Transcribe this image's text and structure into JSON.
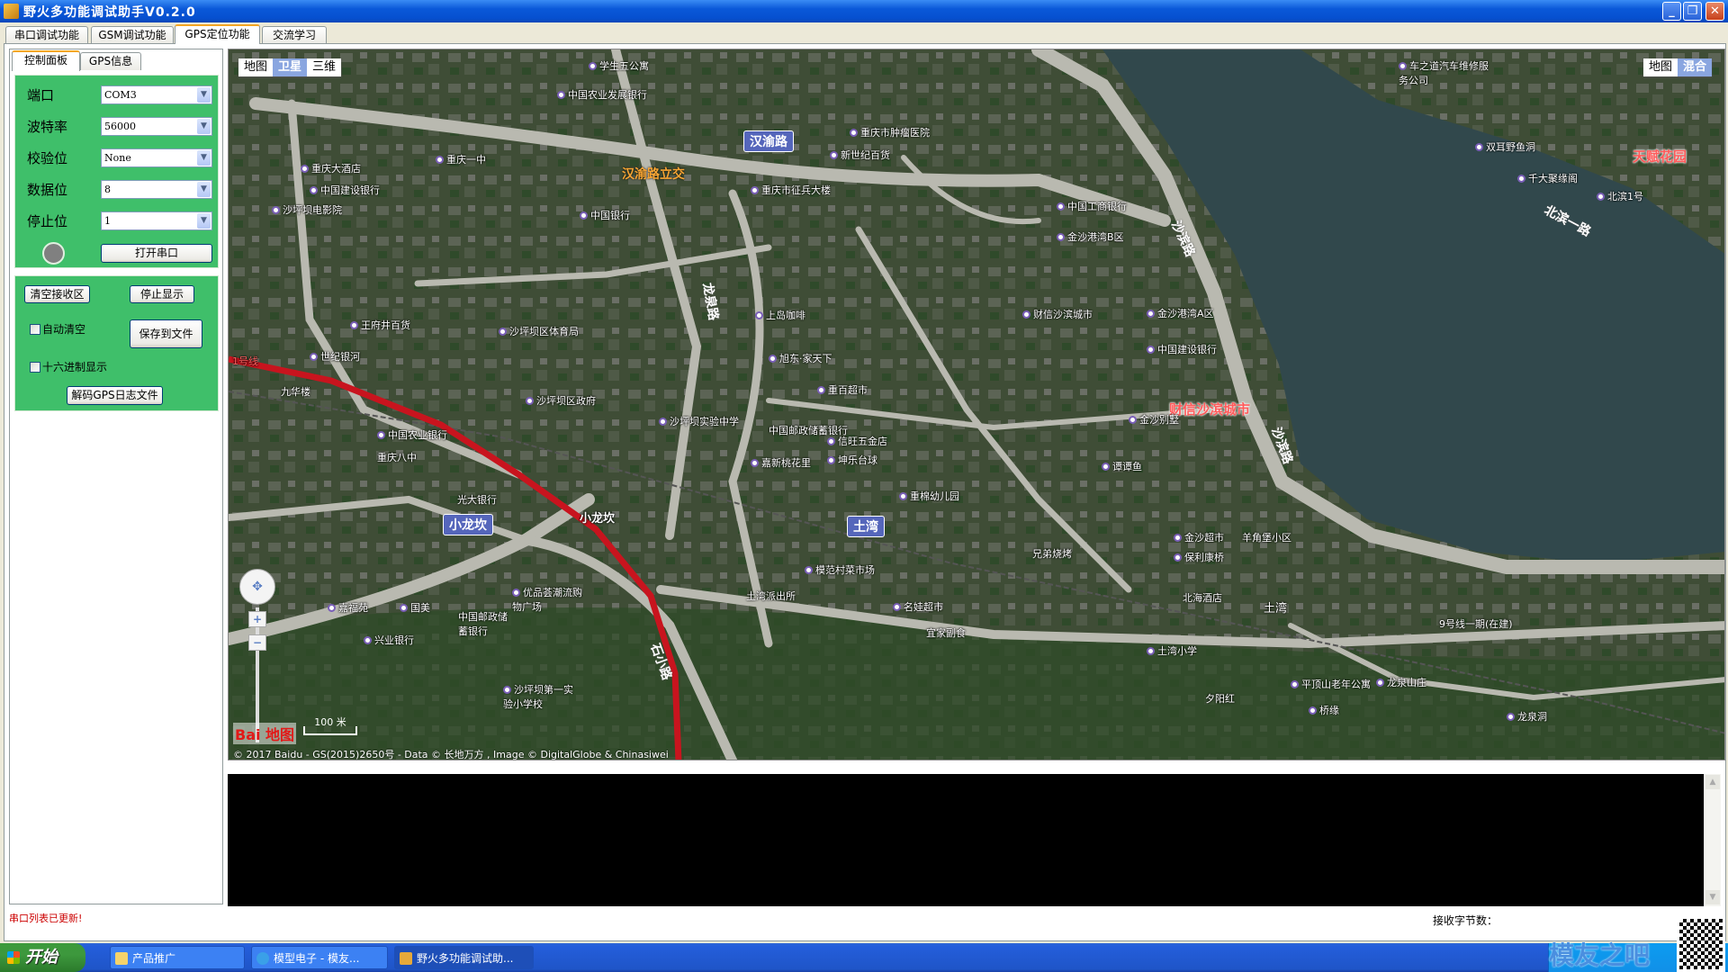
{
  "window": {
    "title": "野火多功能调试助手V0.2.0"
  },
  "main_tabs": [
    "串口调试功能",
    "GSM调试功能",
    "GPS定位功能",
    "交流学习"
  ],
  "sub_tabs": [
    "控制面板",
    "GPS信息"
  ],
  "serial": {
    "port_label": "端口",
    "port_value": "COM3",
    "baud_label": "波特率",
    "baud_value": "56000",
    "parity_label": "校验位",
    "parity_value": "None",
    "databits_label": "数据位",
    "databits_value": "8",
    "stopbits_label": "停止位",
    "stopbits_value": "1",
    "open_button": "打开串口",
    "status_led_color": "#808080"
  },
  "receive": {
    "clear_button": "清空接收区",
    "stop_button": "停止显示",
    "auto_clear_label": "自动清空",
    "auto_clear_checked": false,
    "save_button": "保存到文件",
    "hex_label": "十六进制显示",
    "hex_checked": false,
    "decode_button": "解码GPS日志文件"
  },
  "map": {
    "type_left": [
      "地图",
      "卫星",
      "三维"
    ],
    "type_left_active": "卫星",
    "type_right": [
      "地图",
      "混合"
    ],
    "type_right_active": "混合",
    "scale": "100 米",
    "logo": "Bai 地图",
    "copyright": "© 2017 Baidu - GS(2015)2650号 - Data © 长地万方 , Image © DigitalGlobe & Chinasiwei",
    "districts": [
      "汉渝路",
      "小龙坎",
      "土湾"
    ],
    "highlights": [
      "汉渝路立交",
      "财信沙滨城市",
      "天赋花园"
    ],
    "roads": [
      "沙滨路",
      "北滨一路",
      "石小路",
      "龙泉路",
      "沙滨路",
      "9号线一期(在建)",
      "1号线"
    ],
    "pois": [
      "学生五公寓",
      "重庆一中",
      "中国农业发展银行",
      "重庆市肿瘤医院",
      "新世纪百货",
      "重庆市征兵大楼",
      "中国银行",
      "中国建设银行",
      "中国工商银行",
      "金沙港湾B区",
      "沙坪坝区体育局",
      "王府井百货",
      "世纪银河",
      "九华楼",
      "中国农业银行",
      "重庆八中",
      "光大银行",
      "小龙坎",
      "沙坪坝区政府",
      "沙坪坝实验中学",
      "上岛咖啡",
      "旭东·家天下",
      "重百超市",
      "中国邮政储蓄银行",
      "信旺五金店",
      "坤乐台球",
      "嘉新桃花里",
      "重棉幼儿园",
      "模范村菜市场",
      "土湾派出所",
      "兄弟烧烤",
      "名娃超市",
      "宜家副食",
      "中国建设银行",
      "金沙别墅",
      "谭谭鱼",
      "金沙超市",
      "羊角堡小区",
      "保利康桥",
      "北海酒店",
      "土湾",
      "土湾小学",
      "平顶山老年公寓",
      "龙泉山庄",
      "夕阳红",
      "桥缘",
      "龙泉洞",
      "兴业银行",
      "国美",
      "嘉福苑",
      "优品荟潮流购物广场",
      "沙坪坝第一实验小学校",
      "中国邮政储蓄银行",
      "重庆大酒店",
      "沙坪坝电影院",
      "财信沙滨城市",
      "金沙港湾A区",
      "双耳野鱼洞",
      "千大聚缘阁",
      "北滨1号",
      "车之道汽车维修服务公司"
    ]
  },
  "status": {
    "message": "串口列表已更新!",
    "message_color": "#cc0000",
    "bytes_label": "接收字节数："
  },
  "taskbar": {
    "start": "开始",
    "tasks": [
      "产品推广",
      "模型电子 - 模友...",
      "野火多功能调试助..."
    ],
    "watermark": "模友之吧"
  }
}
